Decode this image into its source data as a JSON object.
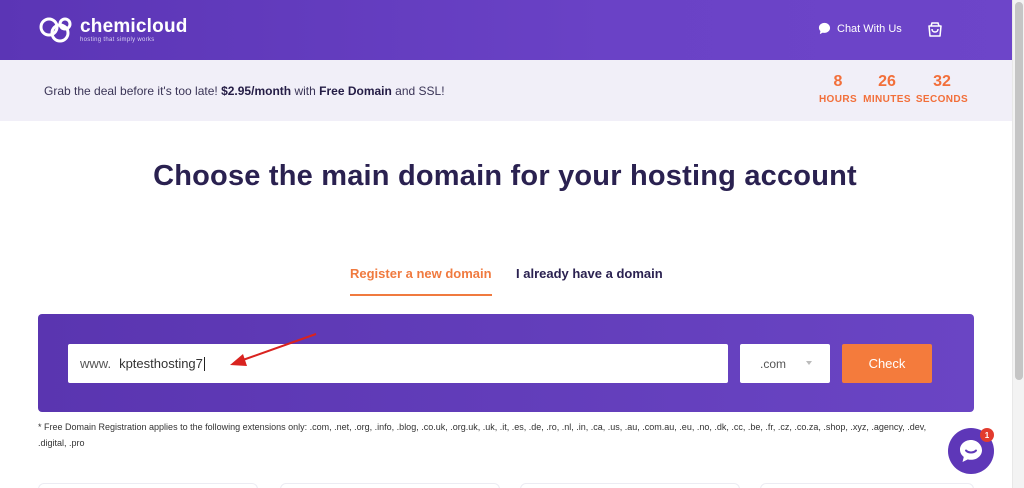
{
  "header": {
    "brand_name": "chemicloud",
    "brand_tagline": "hosting that simply works",
    "chat_label": "Chat With Us"
  },
  "promo": {
    "text_before": "Grab the deal before it's too late!",
    "price": "$2.95/month",
    "text_middle": "with",
    "free_domain": "Free Domain",
    "text_after": "and SSL!",
    "countdown": [
      {
        "value": "8",
        "unit": "HOURS"
      },
      {
        "value": "26",
        "unit": "MINUTES"
      },
      {
        "value": "32",
        "unit": "SECONDS"
      }
    ]
  },
  "main": {
    "title": "Choose the main domain for your hosting account",
    "tabs": [
      {
        "label": "Register a new domain",
        "active": true
      },
      {
        "label": "I already have a domain",
        "active": false
      }
    ],
    "search": {
      "prefix": "www.",
      "value": "kptesthosting7",
      "tld_selected": ".com",
      "check_label": "Check"
    },
    "note": "* Free Domain Registration applies to the following extensions only: .com, .net, .org, .info, .blog, .co.uk, .org.uk, .uk, .it, .es, .de, .ro, .nl, .in, .ca, .us, .au, .com.au, .eu, .no, .dk, .cc, .be, .fr, .cz, .co.za, .shop, .xyz, .agency, .dev, .digital, .pro"
  },
  "chat_widget": {
    "badge_count": "1"
  },
  "colors": {
    "brand_purple": "#5b35b5",
    "accent_orange": "#f47b3c",
    "annotation_red": "#d9231f"
  },
  "icons": [
    "chemicloud-logo-icon",
    "chat-bubble-icon",
    "cart-icon",
    "chevron-down-icon",
    "chat-widget-icon"
  ]
}
